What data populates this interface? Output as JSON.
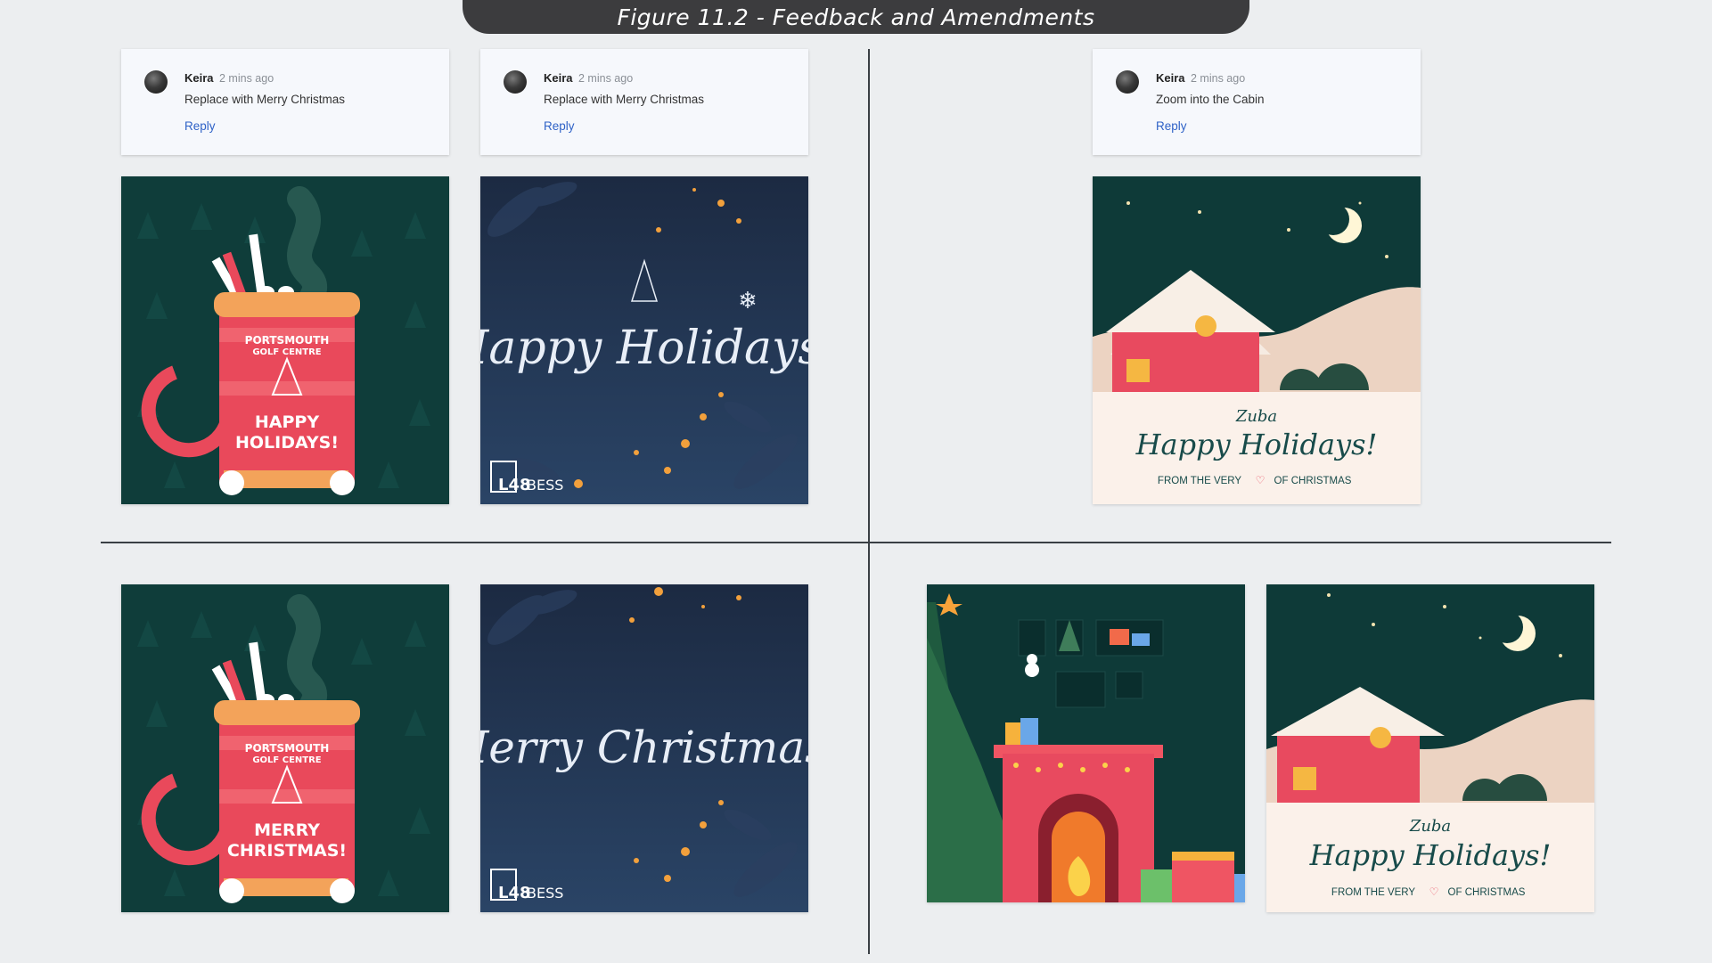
{
  "header": {
    "title": "Figure 11.2 - Feedback and Amendments"
  },
  "comments": [
    {
      "author": "Keira",
      "time": "2 mins ago",
      "text": "Replace with Merry Christmas",
      "reply": "Reply"
    },
    {
      "author": "Keira",
      "time": "2 mins ago",
      "text": "Replace with Merry Christmas",
      "reply": "Reply"
    },
    {
      "author": "Keira",
      "time": "2 mins ago",
      "text": "Zoom into the Cabin",
      "reply": "Reply"
    }
  ],
  "cards": {
    "mug_before": {
      "brand_line1": "PORTSMOUTH",
      "brand_line2": "GOLF CENTRE",
      "greeting_line1": "HAPPY",
      "greeting_line2": "HOLIDAYS!"
    },
    "mug_after": {
      "brand_line1": "PORTSMOUTH",
      "brand_line2": "GOLF CENTRE",
      "greeting_line1": "MERRY",
      "greeting_line2": "CHRISTMAS!"
    },
    "night_before": {
      "greeting": "Happy Holidays!",
      "logo_mark": "L48",
      "logo_text": "BESS"
    },
    "night_after": {
      "greeting": "Merry Christmas!",
      "logo_mark": "L48",
      "logo_text": "BESS"
    },
    "cabin_before": {
      "logo": "Zuba",
      "greeting": "Happy Holidays!",
      "tagline_left": "FROM THE VERY",
      "tagline_right": "OF CHRISTMAS"
    },
    "cabin_after": {
      "logo": "Zuba",
      "greeting": "Happy Holidays!",
      "tagline_left": "FROM THE VERY",
      "tagline_right": "OF CHRISTMAS"
    }
  },
  "colors": {
    "title_bar": "#3c3c3e",
    "mug_bg": "#0f3d3a",
    "mug_red": "#e9495b",
    "mug_rim": "#f3a35a",
    "night_bg": "#1f3350",
    "cabin_sky": "#0e3a38",
    "cabin_red": "#e84a5f",
    "link": "#2f62c7"
  }
}
